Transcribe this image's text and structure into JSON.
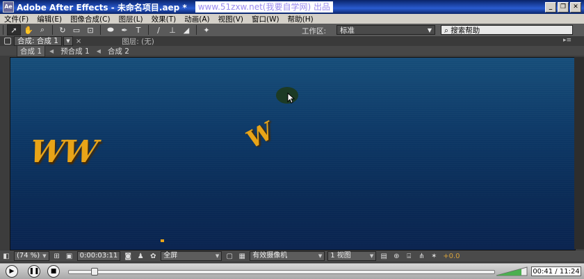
{
  "window": {
    "app_icon_text": "Ae",
    "title": "Adobe After Effects - 未命名项目.aep *",
    "watermark": "www.51zxw.net(我要自学网) 出品"
  },
  "menu": [
    "文件(F)",
    "编辑(E)",
    "图像合成(C)",
    "图层(L)",
    "效果(T)",
    "动画(A)",
    "视图(V)",
    "窗口(W)",
    "帮助(H)"
  ],
  "toolbar": {
    "workspace_label": "工作区:",
    "workspace_value": "标准",
    "search_placeholder": "搜索帮助"
  },
  "panel": {
    "comp_tab": "合成: 合成 1",
    "layer_tab": "图层: (无)"
  },
  "breadcrumbs": [
    "合成 1",
    "预合成 1",
    "合成 2"
  ],
  "viewer": {
    "text_ww": "WW",
    "text_w": "W"
  },
  "viewer_controls": {
    "zoom": "(74 %)",
    "timecode": "0:00:03:11",
    "resolution": "全屏",
    "camera": "有效摄像机",
    "views": "1 视图",
    "exposure": "+0.0"
  },
  "player": {
    "progress_fraction": 0.06,
    "time": "00:41 / 11:24"
  },
  "colors": {
    "accent_text": "#e8a418",
    "title_bar": "#0a246a"
  }
}
